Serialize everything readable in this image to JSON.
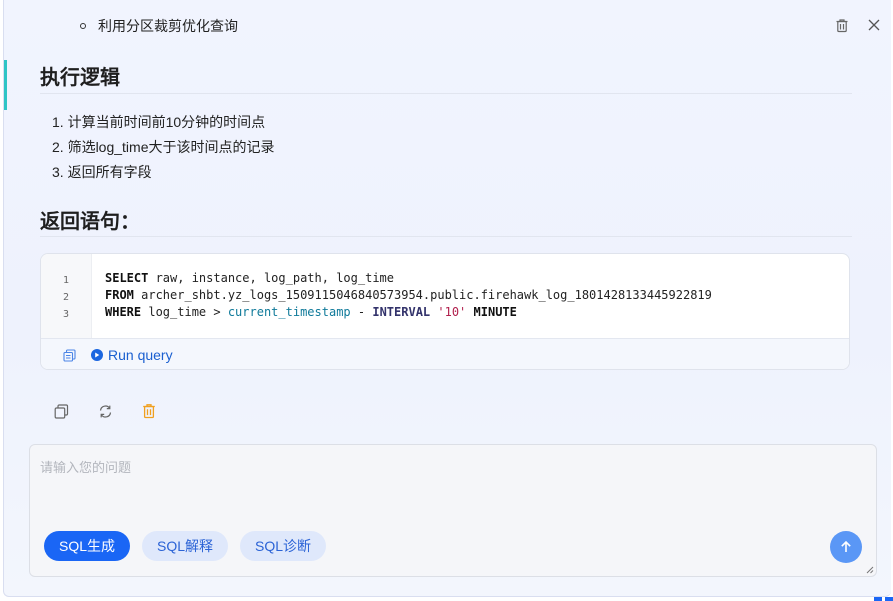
{
  "header": {
    "bullet_text": "利用分区裁剪优化查询",
    "delete_icon": "trash-icon",
    "close_icon": "close-icon"
  },
  "logic_section": {
    "title": "执行逻辑",
    "steps": [
      "1. 计算当前时间前10分钟的时间点",
      "2. 筛选log_time大于该时间点的记录",
      "3. 返回所有字段"
    ]
  },
  "return_section": {
    "title": "返回语句："
  },
  "code_block": {
    "line_numbers": [
      "1",
      "2",
      "3"
    ],
    "lines": [
      {
        "kw": "SELECT",
        "rest": " raw, instance, log_path, log_time"
      },
      {
        "kw": "FROM",
        "rest": " archer_shbt.yz_logs_1509115046840573954.public.firehawk_log_1801428133445922819"
      },
      {
        "kw": "WHERE",
        "rest1": " log_time > ",
        "fn": "current_timestamp",
        "op": " - ",
        "kw2": "INTERVAL",
        "sp": " ",
        "str": "'10'",
        "sp2": " ",
        "kw3": "MINUTE"
      }
    ],
    "run_label": "Run query",
    "copy_icon": "copy-icon",
    "play_icon": "play-icon"
  },
  "message_actions": {
    "copy_icon": "copy-icon",
    "refresh_icon": "refresh-icon",
    "delete_icon": "trash-icon"
  },
  "composer": {
    "placeholder": "请输入您的问题",
    "value": "",
    "chips": [
      {
        "label": "SQL生成",
        "active": true
      },
      {
        "label": "SQL解释",
        "active": false
      },
      {
        "label": "SQL诊断",
        "active": false
      }
    ],
    "send_icon": "arrow-up-icon"
  },
  "colors": {
    "accent": "#1a66f5",
    "chip_inactive_bg": "#dfe8fb",
    "send_button": "#5a97f6",
    "delete_orange": "#f0a020"
  }
}
